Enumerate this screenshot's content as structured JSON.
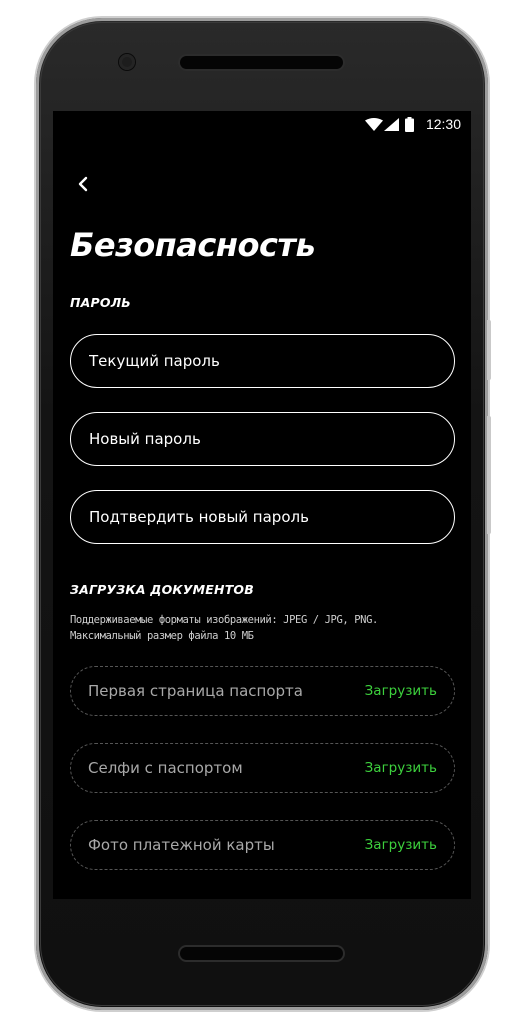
{
  "status_bar": {
    "time": "12:30",
    "icons": [
      "wifi-icon",
      "signal-icon",
      "battery-icon"
    ]
  },
  "header": {
    "back_icon": "chevron-left-icon",
    "title": "Безопасность"
  },
  "password_section": {
    "title": "ПАРОЛЬ",
    "fields": [
      {
        "placeholder": "Текущий пароль",
        "value": ""
      },
      {
        "placeholder": "Новый пароль",
        "value": ""
      },
      {
        "placeholder": "Подтвердить новый пароль",
        "value": ""
      }
    ]
  },
  "documents_section": {
    "title": "ЗАГРУЗКА ДОКУМЕНТОВ",
    "hint_line1": "Поддерживаемые форматы изображений: JPEG / JPG, PNG.",
    "hint_line2": "Максимальный размер файла 10 МБ",
    "uploads": [
      {
        "label": "Первая страница паспорта",
        "action": "Загрузить"
      },
      {
        "label": "Селфи с паспортом",
        "action": "Загрузить"
      },
      {
        "label": "Фото платежной карты",
        "action": "Загрузить"
      }
    ]
  },
  "colors": {
    "background": "#000000",
    "text": "#ffffff",
    "accent": "#3dd13d",
    "muted_text": "#a8a8a8",
    "dashed_border": "#555555"
  }
}
